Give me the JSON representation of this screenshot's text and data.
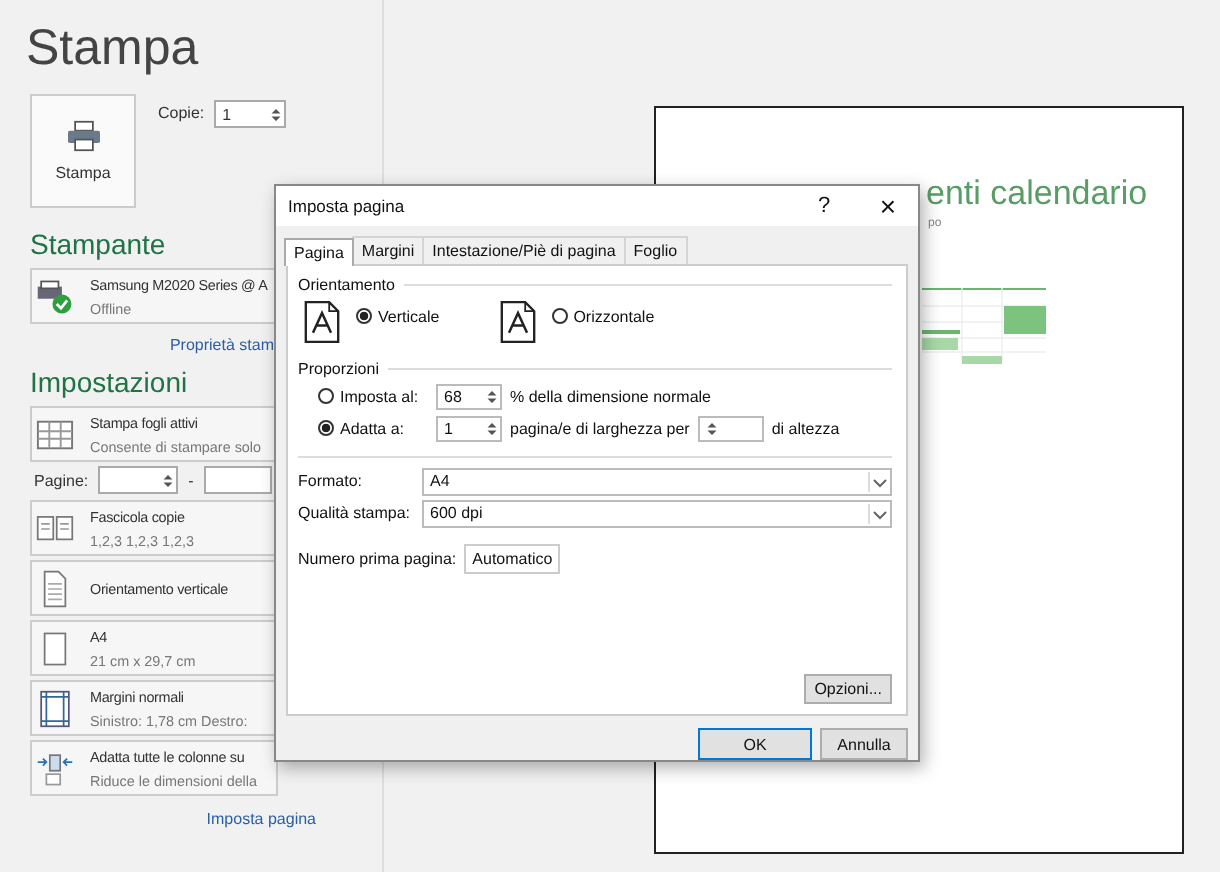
{
  "page_title": "Stampa",
  "print_button": {
    "label": "Stampa"
  },
  "copies": {
    "label": "Copie:",
    "value": "1"
  },
  "printer_section": {
    "heading": "Stampante",
    "printer": {
      "name": "Samsung M2020 Series @ A",
      "status": "Offline"
    },
    "link": "Proprietà stam"
  },
  "settings_section": {
    "heading": "Impostazioni",
    "items": [
      {
        "kind": "sheets",
        "title": "Stampa fogli attivi",
        "subtitle": "Consente di stampare solo"
      },
      {
        "kind": "pages",
        "label": "Pagine:",
        "separator": "-"
      },
      {
        "kind": "collate",
        "title": "Fascicola copie",
        "subtitle": "1,2,3    1,2,3    1,2,3"
      },
      {
        "kind": "orientation",
        "title": "Orientamento verticale"
      },
      {
        "kind": "paper",
        "title": "A4",
        "subtitle": "21 cm x 29,7 cm"
      },
      {
        "kind": "margins",
        "title": "Margini normali",
        "subtitle": "Sinistro:  1,78 cm    Destro:"
      },
      {
        "kind": "scaling",
        "title": "Adatta tutte le colonne su",
        "subtitle": "Riduce le dimensioni della"
      }
    ],
    "link": "Imposta pagina"
  },
  "preview": {
    "title": "enti calendario",
    "subtitle": "po"
  },
  "dialog": {
    "title": "Imposta pagina",
    "help": "?",
    "close": "×",
    "tabs": [
      {
        "label": "Pagina",
        "selected": true
      },
      {
        "label": "Margini",
        "selected": false
      },
      {
        "label": "Intestazione/Piè di pagina",
        "selected": false
      },
      {
        "label": "Foglio",
        "selected": false
      }
    ],
    "orientation": {
      "legend": "Orientamento",
      "options": [
        {
          "label": "Verticale",
          "selected": true
        },
        {
          "label": "Orizzontale",
          "selected": false
        }
      ]
    },
    "scaling": {
      "legend": "Proporzioni",
      "options": [
        {
          "kind": "percent",
          "label": "Imposta al:",
          "selected": false,
          "value": "68",
          "suffix": "% della dimensione normale"
        },
        {
          "kind": "fit",
          "label": "Adatta a:",
          "selected": true,
          "value": "1",
          "middle": "pagina/e di larghezza per",
          "suffix": "di altezza"
        }
      ]
    },
    "fields": [
      {
        "label": "Formato:",
        "value": "A4"
      },
      {
        "label": "Qualità stampa:",
        "value": "600 dpi"
      }
    ],
    "first_page": {
      "label": "Numero prima pagina:",
      "value": "Automatico"
    },
    "options_button": "Opzioni...",
    "buttons": [
      {
        "label": "OK",
        "default": true
      },
      {
        "label": "Annulla",
        "default": false
      }
    ]
  }
}
